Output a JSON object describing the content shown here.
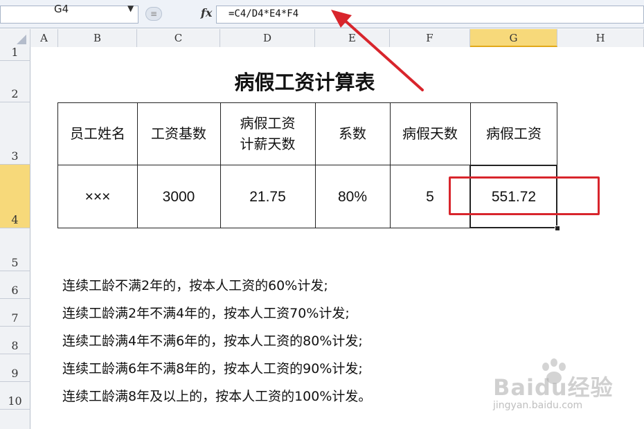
{
  "name_box": {
    "value": "G4"
  },
  "formula_bar": {
    "fx_label": "fx",
    "formula": "=C4/D4*E4*F4"
  },
  "columns": [
    "A",
    "B",
    "C",
    "D",
    "E",
    "F",
    "G",
    "H"
  ],
  "rows": [
    "1",
    "2",
    "3",
    "4",
    "5",
    "6",
    "7",
    "8",
    "9",
    "10"
  ],
  "selected_column": "G",
  "selected_row": "4",
  "sheet": {
    "title": "病假工资计算表",
    "headers": [
      "员工姓名",
      "工资基数",
      "病假工资\n计薪天数",
      "系数",
      "病假天数",
      "病假工资"
    ],
    "values": [
      "×××",
      "3000",
      "21.75",
      "80%",
      "5",
      "551.72"
    ],
    "notes": [
      "连续工龄不满2年的，按本人工资的60%计发;",
      "连续工龄满2年不满4年的，按本人工资70%计发;",
      "连续工龄满4年不满6年的，按本人工资的80%计发;",
      "连续工龄满6年不满8年的，按本人工资的90%计发;",
      "连续工龄满8年及以上的，按本人工资的100%计发。"
    ]
  },
  "watermark": {
    "logo": "Baidu经验",
    "url": "jingyan.baidu.com"
  },
  "colors": {
    "annotation_red": "#d8252c",
    "selection_header": "#f7d97a"
  }
}
